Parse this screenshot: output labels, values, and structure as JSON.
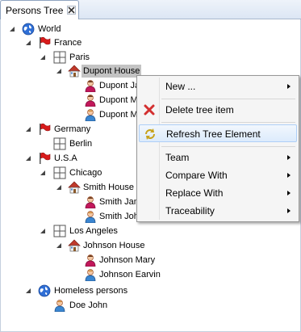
{
  "tab": {
    "title": "Persons Tree",
    "close_icon": "close-icon"
  },
  "tree": {
    "world": "World",
    "france": "France",
    "paris": "Paris",
    "dupont_house": "Dupont House",
    "dupont_ja": "Dupont Ja",
    "dupont_m1": "Dupont M",
    "dupont_m2": "Dupont M",
    "germany": "Germany",
    "berlin": "Berlin",
    "usa": "U.S.A",
    "chicago": "Chicago",
    "smith_house": "Smith House",
    "smith_jan": "Smith Jan",
    "smith_joh": "Smith Joh",
    "los_angeles": "Los Angeles",
    "johnson_house": "Johnson House",
    "johnson_mary": "Johnson Mary",
    "johnson_earvin": "Johnson Earvin",
    "homeless": "Homeless persons",
    "doe_john": "Doe John"
  },
  "context_menu": {
    "new": "New ...",
    "delete": "Delete tree item",
    "refresh": "Refresh Tree Element",
    "team": "Team",
    "compare": "Compare With",
    "replace": "Replace With",
    "traceability": "Traceability"
  },
  "colors": {
    "selection": "#c3c3c3",
    "menu_highlight": "#dcebfc",
    "flag_red": "#d81b1b",
    "globe_blue": "#2f6fd6"
  }
}
